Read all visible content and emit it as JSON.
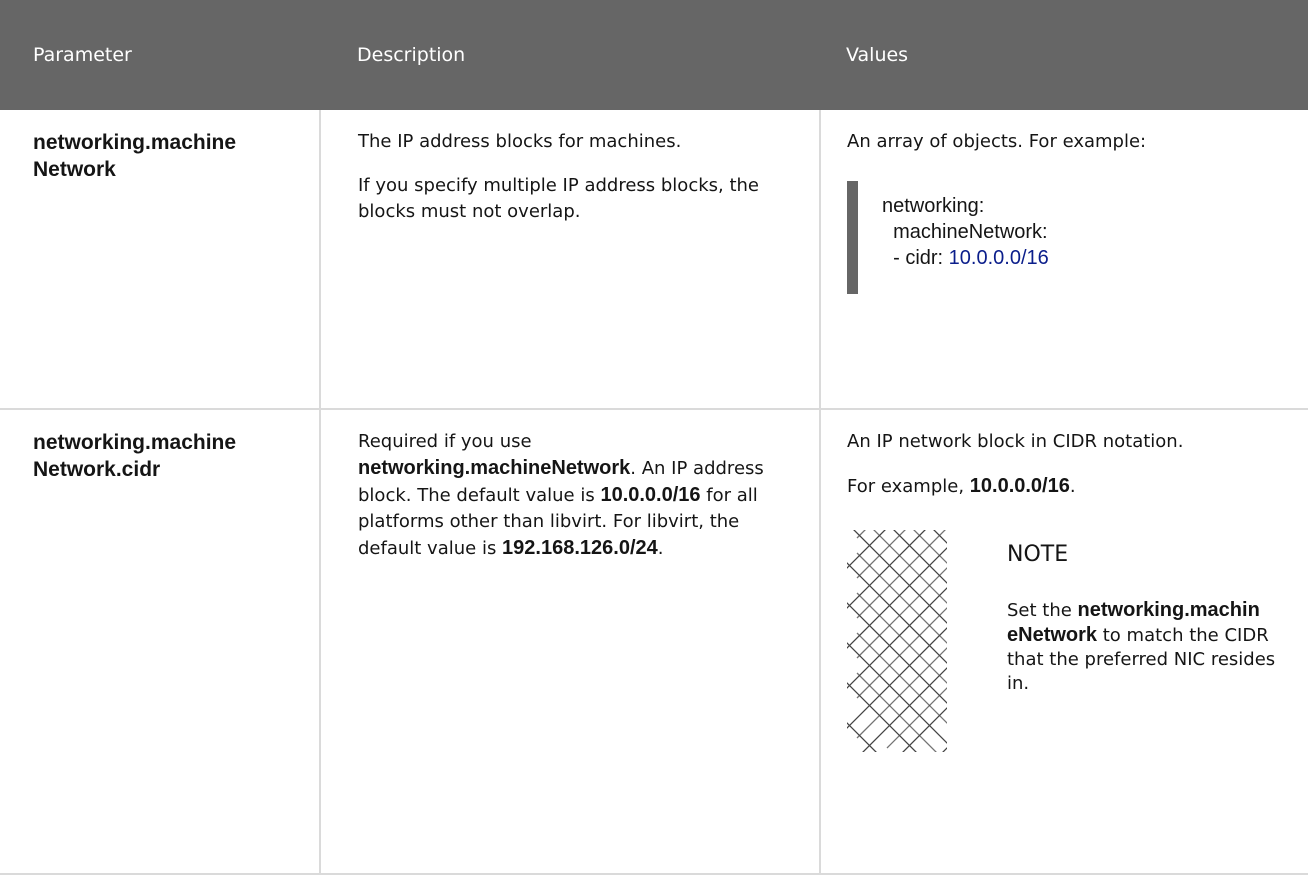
{
  "header": {
    "parameter": "Parameter",
    "description": "Description",
    "values": "Values"
  },
  "rows": [
    {
      "param": "networking.machine Network",
      "desc_p1": "The IP address blocks for machines.",
      "desc_p2": "If you specify multiple IP address blocks, the blocks must not overlap.",
      "values_intro": "An array of objects. For example:",
      "code": {
        "line1": "networking:",
        "line2": "  machineNetwork:",
        "line3_prefix": "  - cidr: ",
        "line3_value": "10.0.0.0/16"
      }
    },
    {
      "param": "networking.machine Network.cidr",
      "desc_a": "Required if you use ",
      "desc_b": "networking.machineNetwork",
      "desc_c": ". An IP address block. The default value is ",
      "desc_d": "10.0.0.0/16",
      "desc_e": " for all platforms other than libvirt. For libvirt, the default value is ",
      "desc_f": "192.168.126.0/24",
      "desc_g": ".",
      "values_p1": "An IP network block in CIDR notation.",
      "values_p2_a": "For example, ",
      "values_p2_b": "10.0.0.0/16",
      "values_p2_c": ".",
      "note": {
        "icon": "note-pattern-icon",
        "title": "NOTE",
        "text_a": "Set the ",
        "text_b": "networking.machin eNetwork",
        "text_c": " to match the CIDR that the preferred NIC resides in."
      }
    }
  ]
}
